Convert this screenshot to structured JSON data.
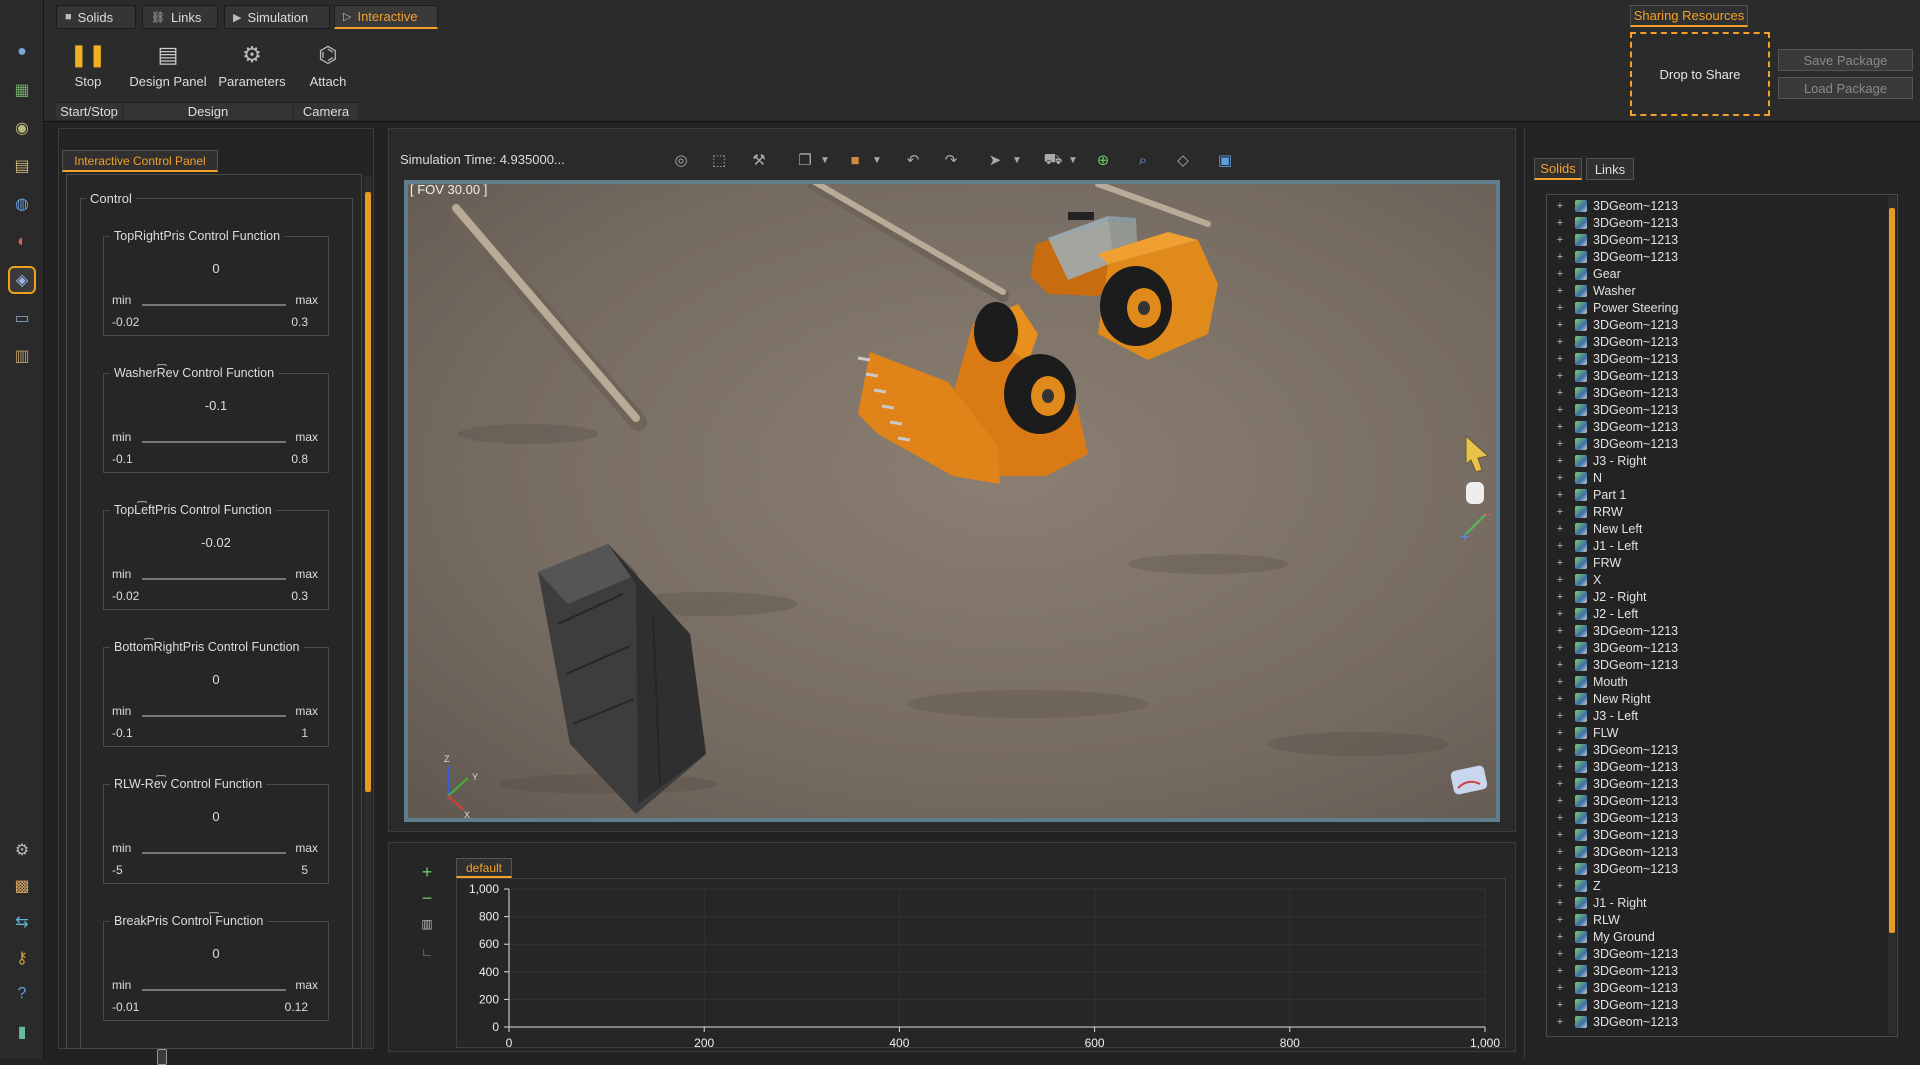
{
  "tabs": [
    {
      "label": "Solids",
      "icon": "cube-icon"
    },
    {
      "label": "Links",
      "icon": "link-icon"
    },
    {
      "label": "Simulation",
      "icon": "play-icon"
    },
    {
      "label": "Interactive",
      "icon": "play-outline-icon"
    }
  ],
  "ribbon": {
    "stop": "Stop",
    "design_panel": "Design Panel",
    "parameters": "Parameters",
    "attach": "Attach",
    "groups": {
      "start_stop": "Start/Stop",
      "design": "Design",
      "camera": "Camera"
    }
  },
  "sharing": {
    "title": "Sharing Resources",
    "drop": "Drop to Share",
    "save": "Save Package",
    "load": "Load Package"
  },
  "left_panel": {
    "tab": "Interactive Control Panel",
    "group": "Control",
    "min_label": "min",
    "max_label": "max",
    "functions": [
      {
        "title": "TopRightPris Control Function",
        "value": "0",
        "min": "-0.02",
        "max": "0.3",
        "level": 0.14
      },
      {
        "title": "WasherRev Control Function",
        "value": "-0.1",
        "min": "-0.1",
        "max": "0.8",
        "level": 0.0
      },
      {
        "title": "TopLeftPris Control Function",
        "value": "-0.02",
        "min": "-0.02",
        "max": "0.3",
        "level": 0.05
      },
      {
        "title": "BottomRightPris Control Function",
        "value": "0",
        "min": "-0.1",
        "max": "1",
        "level": 0.13
      },
      {
        "title": "RLW-Rev Control Function",
        "value": "0",
        "min": "-5",
        "max": "5",
        "level": 0.5
      },
      {
        "title": "BreakPris Control Function",
        "value": "0",
        "min": "-0.01",
        "max": "0.12",
        "level": 0.14
      }
    ]
  },
  "viewport": {
    "sim_time": "Simulation Time: 4.935000...",
    "fov": "[ FOV 30.00 ]",
    "axis_x": "X",
    "axis_y": "Y",
    "axis_z": "Z"
  },
  "graph": {
    "tab": "default"
  },
  "chart_data": {
    "type": "line",
    "title": "",
    "xlabel": "",
    "ylabel": "",
    "xlim": [
      0,
      1000
    ],
    "ylim": [
      0,
      1000
    ],
    "x_ticks": [
      "0",
      "200",
      "400",
      "600",
      "800",
      "1,000"
    ],
    "y_ticks": [
      "0",
      "200",
      "400",
      "600",
      "800",
      "1,000"
    ],
    "series": [],
    "grid": true
  },
  "right_panel": {
    "tabs": [
      "Solids",
      "Links"
    ],
    "tree": [
      "3DGeom~1213",
      "3DGeom~1213",
      "3DGeom~1213",
      "3DGeom~1213",
      "Gear",
      "Washer",
      "Power Steering",
      "3DGeom~1213",
      "3DGeom~1213",
      "3DGeom~1213",
      "3DGeom~1213",
      "3DGeom~1213",
      "3DGeom~1213",
      "3DGeom~1213",
      "3DGeom~1213",
      "J3 - Right",
      "N",
      "Part 1",
      "RRW",
      "New Left",
      "J1 - Left",
      "FRW",
      "X",
      "J2 - Right",
      "J2 - Left",
      "3DGeom~1213",
      "3DGeom~1213",
      "3DGeom~1213",
      "Mouth",
      "New Right",
      "J3 - Left",
      "FLW",
      "3DGeom~1213",
      "3DGeom~1213",
      "3DGeom~1213",
      "3DGeom~1213",
      "3DGeom~1213",
      "3DGeom~1213",
      "3DGeom~1213",
      "3DGeom~1213",
      "Z",
      "J1 - Right",
      "RLW",
      "My Ground",
      "3DGeom~1213",
      "3DGeom~1213",
      "3DGeom~1213",
      "3DGeom~1213",
      "3DGeom~1213"
    ]
  },
  "colors": {
    "accent": "#f3a02a",
    "loader": "#e07a14",
    "ground": "#7d7268"
  }
}
